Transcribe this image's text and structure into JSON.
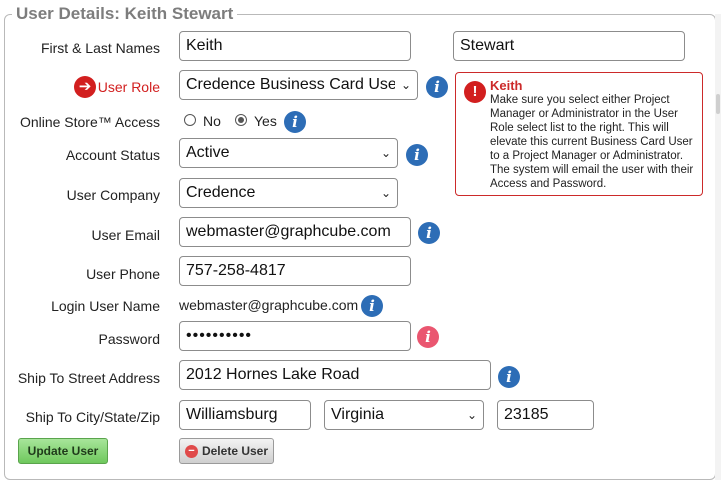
{
  "section": {
    "legend": "User Details: Keith Stewart"
  },
  "labels": {
    "name": "First & Last Names",
    "role": "User Role",
    "online": "Online Store™ Access",
    "status": "Account Status",
    "company": "User Company",
    "email": "User Email",
    "phone": "User Phone",
    "login": "Login User Name",
    "password": "Password",
    "street": "Ship To Street Address",
    "city": "Ship To City/State/Zip"
  },
  "fields": {
    "first_name": "Keith",
    "last_name": "Stewart",
    "role": "Credence Business Card User",
    "online_no": "No",
    "online_yes": "Yes",
    "online_selected": "Yes",
    "status": "Active",
    "company": "Credence",
    "email": "webmaster@graphcube.com",
    "phone": "757-258-4817",
    "login": "webmaster@graphcube.com",
    "password": "••••••••••",
    "street": "2012 Hornes Lake Road",
    "city": "Williamsburg",
    "state": "Virginia",
    "zip": "23185"
  },
  "alert": {
    "name": "Keith",
    "message": "Make sure you select either Project Manager or Administrator in the User Role select list to the right. This will elevate this current Business Card User to a Project Manager or Administrator. The system will email the user with their Access and Password."
  },
  "buttons": {
    "update": "Update User",
    "delete": "Delete User"
  },
  "icons": {
    "info": "i",
    "arrow": "➔",
    "alert": "!",
    "minus": "−",
    "chevron": "⌄"
  },
  "colors": {
    "info": "#2d6db6",
    "danger": "#d21f1f",
    "warning_info": "#ea5670",
    "update_button": "#6fc85d"
  }
}
